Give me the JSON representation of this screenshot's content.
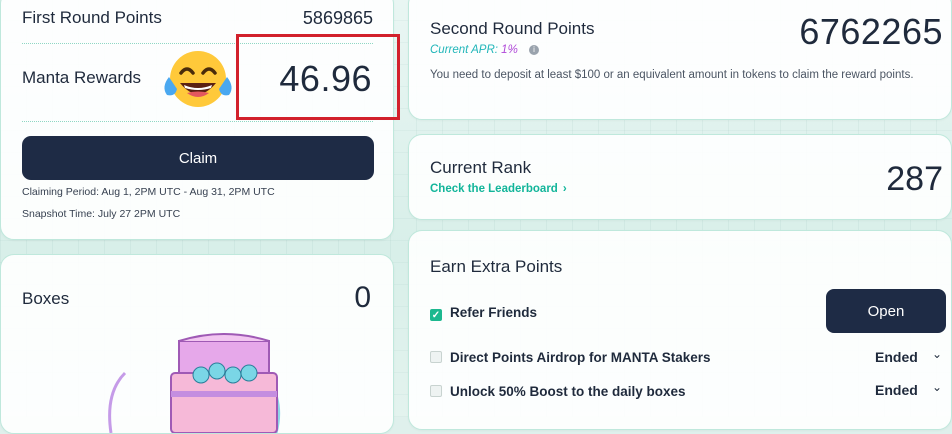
{
  "first_round": {
    "label": "First Round Points",
    "value": "5869865",
    "rewards_label": "Manta Rewards",
    "rewards_value": "46.96",
    "claim_label": "Claim",
    "claiming_period": "Claiming Period: Aug 1, 2PM UTC - Aug 31, 2PM UTC",
    "snapshot_time": "Snapshot Time: July 27 2PM UTC",
    "emoji_icon": "face-with-tears-of-joy",
    "highlight_color": "#d2212c"
  },
  "boxes": {
    "label": "Boxes",
    "value": "0",
    "image_icon": "treasure-chest"
  },
  "second_round": {
    "label": "Second Round Points",
    "apr_label": "Current APR:",
    "apr_value": "1%",
    "info_glyph": "i",
    "value": "6762265",
    "note": "You need to deposit at least $100 or an equivalent amount in tokens to claim the reward points."
  },
  "rank": {
    "label": "Current Rank",
    "link": "Check the Leaderboard",
    "chevron": "›",
    "value": "287"
  },
  "earn": {
    "title": "Earn Extra Points",
    "tasks": [
      {
        "label": "Refer Friends",
        "checked": true,
        "action": "Open"
      },
      {
        "label": "Direct Points Airdrop for MANTA Stakers",
        "checked": false,
        "status": "Ended"
      },
      {
        "label": "Unlock 50% Boost to the daily boxes",
        "checked": false,
        "status": "Ended"
      }
    ],
    "check_glyph": "✓",
    "expand_glyph": "⌄"
  },
  "colors": {
    "primary_button": "#1e2b45",
    "accent_teal": "#12b59a",
    "apr_purple": "#b04ad8",
    "card_border": "#bfe8dc"
  }
}
